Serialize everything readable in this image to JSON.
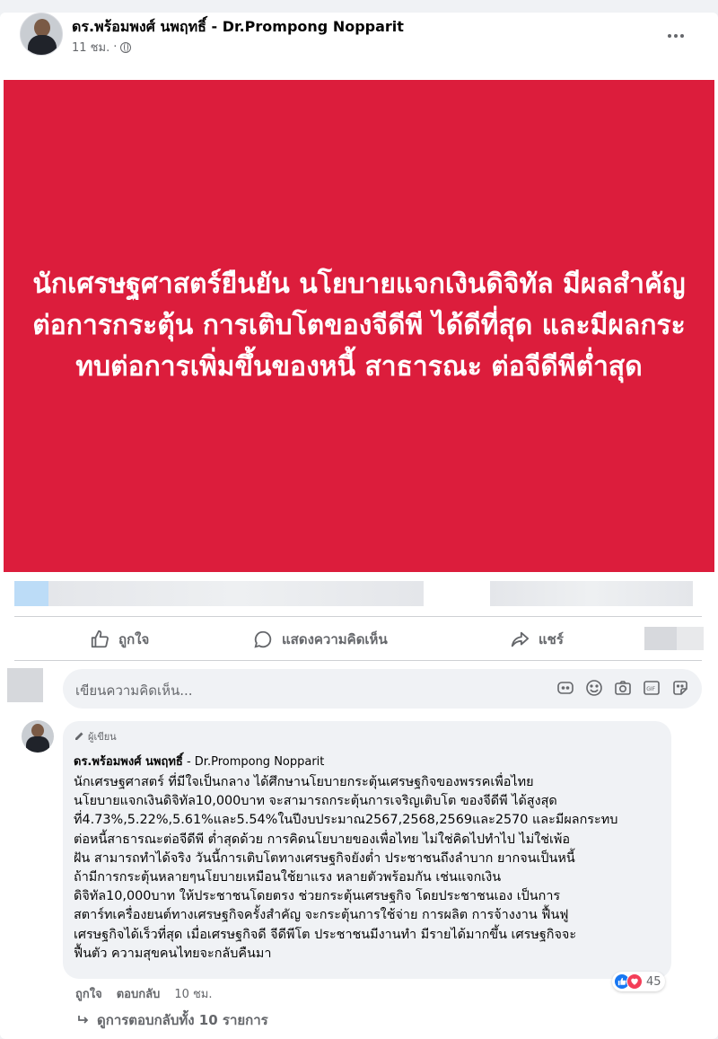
{
  "post": {
    "author": "ดร.พร้อมพงศ์ นพฤทธิ์ - Dr.Prompong Nopparit",
    "time": "11 ชม.",
    "banner_text": "นักเศรษฐศาสตร์ยืนยัน นโยบายแจกเงินดิจิทัล มีผลสำคัญต่อการกระตุ้น การเติบโตของจีดีพี ได้ดีที่สุด และมีผลกระทบต่อการเพิ่มขึ้นของหนี้ สาธารณะ ต่อจีดีพีต่ำสุด",
    "banner_color": "#dc1d3c"
  },
  "actions": {
    "like": "ถูกใจ",
    "comment": "แสดงความคิดเห็น",
    "share": "แชร์"
  },
  "composer": {
    "placeholder": "เขียนความคิดเห็น..."
  },
  "comment": {
    "badge": "ผู้เขียน",
    "author_th": "ดร.พร้อมพงศ์ นพฤทธิ์",
    "author_en": " - Dr.Prompong Nopparit",
    "body": "นักเศรษฐศาสตร์ ที่มีใจเป็นกลาง ได้ศึกษานโยบายกระตุ้นเศรษฐกิจของพรรคเพื่อไทย\nนโยบายแจกเงินดิจิทัล10,000บาท จะสามารถกระตุ้นการเจริญเติบโต ของจีดีพี ได้สูงสุด\nที่4.73%,5.22%,5.61%และ5.54%ในปีงบประมาณ2567,2568,2569และ2570 และมีผลกระทบ\nต่อหนี้สาธารณะต่อจีดีพี ต่ำสุดด้วย การคิดนโยบายของเพื่อไทย ไม่ใช่คิดไปทำไป ไม่ใช่เพ้อ\nฝัน สามารถทำได้จริง วันนี้การเติบโตทางเศรษฐกิจยังต่ำ ประชาชนถึงลำบาก ยากจนเป็นหนี้\nถ้ามีการกระตุ้นหลายๆนโยบายเหมือนใช้ยาแรง หลายตัวพร้อมกัน เช่นแจกเงิน\nดิจิทัล10,000บาท ให้ประชาชนโดยตรง ช่วยกระตุ้นเศรษฐกิจ โดยประชาชนเอง เป็นการ\nสตาร์ทเครื่องยนต์ทางเศรษฐกิจครั้งสำคัญ จะกระตุ้นการใช้จ่าย การผลิต การจ้างงาน ฟื้นฟู\nเศรษฐกิจได้เร็วที่สุด เมื่อเศรษฐกิจดี จีดีพีโต ประชาชนมีงานทำ มีรายได้มากขึ้น เศรษฐกิจจะ\nฟื้นตัว ความสุขคนไทยจะกลับคืนมา",
    "like": "ถูกใจ",
    "reply": "ตอบกลับ",
    "time": "10 ชม.",
    "reaction_count": "45",
    "view_replies": "ดูการตอบกลับทั้ง 10 รายการ"
  }
}
